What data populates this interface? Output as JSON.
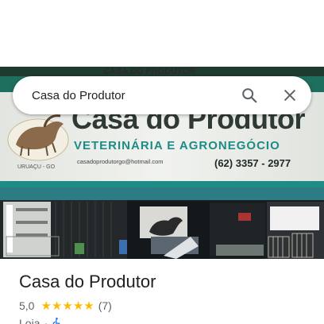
{
  "search": {
    "query": "Casa do Produtor",
    "search_icon": "search-icon",
    "close_icon": "close-icon"
  },
  "photo": {
    "sign_top_text": "CASA DO PRODUTOR",
    "sign_title": "Casa do Produtor",
    "sign_subtitle": "VETERINÁRIA E AGRONEGÓCIO",
    "sign_email": "casadoprodutorgo@hotmail.com",
    "sign_phone": "(62) 3357 - 2977",
    "logo_caption": "URUAÇU - GO"
  },
  "place": {
    "name": "Casa do Produtor",
    "rating": "5,0",
    "stars": 5,
    "review_count": "(7)",
    "category": "Loja",
    "separator": "·",
    "accessibility_icon": "wheelchair-icon"
  },
  "colors": {
    "sign_teal": "#1e8b86",
    "star": "#fbbc04",
    "text_primary": "#202124",
    "text_secondary": "#5f6368"
  }
}
